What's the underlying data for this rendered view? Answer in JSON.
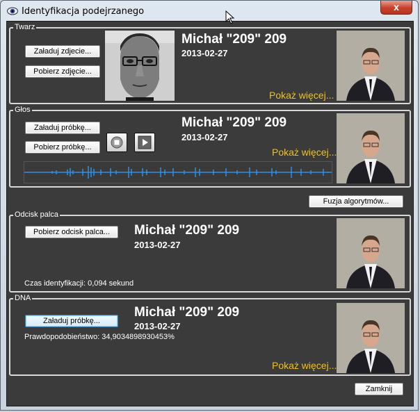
{
  "window": {
    "title": "Identyfikacja podejrzanego",
    "close_label": "x"
  },
  "groups": {
    "face": {
      "legend": "Twarz",
      "load_button": "Załaduj zdjecie...",
      "fetch_button": "Pobierz zdjęcie...",
      "name": "Michał \"209\" 209",
      "date": "2013-02-27",
      "more_link": "Pokaż więcej..."
    },
    "voice": {
      "legend": "Głos",
      "load_button": "Załaduj próbkę...",
      "fetch_button": "Pobierz próbkę...",
      "name": "Michał \"209\" 209",
      "date": "2013-02-27",
      "more_link": "Pokaż więcej..."
    },
    "fingerprint": {
      "legend": "Odcisk palca",
      "fetch_button": "Pobierz odcisk palca...",
      "name": "Michał \"209\" 209",
      "date": "2013-02-27",
      "time_info": "Czas identyfikacji: 0,094 sekund"
    },
    "dna": {
      "legend": "DNA",
      "load_button": "Załaduj próbkę...",
      "name": "Michał \"209\" 209",
      "date": "2013-02-27",
      "probability": "Prawdopodobieństwo: 34,9034898930453%",
      "more_link": "Pokaż więcej..."
    }
  },
  "fusion_button": "Fuzja algorytmów...",
  "close_button": "Zamknij",
  "colors": {
    "panel_bg": "#3b3b3b",
    "accent_link": "#f0c21a",
    "waveform": "#2f8fe8"
  },
  "icons": {
    "app": "eye-icon",
    "stop": "stop-icon",
    "play": "play-icon",
    "cursor": "mouse-cursor-icon"
  }
}
